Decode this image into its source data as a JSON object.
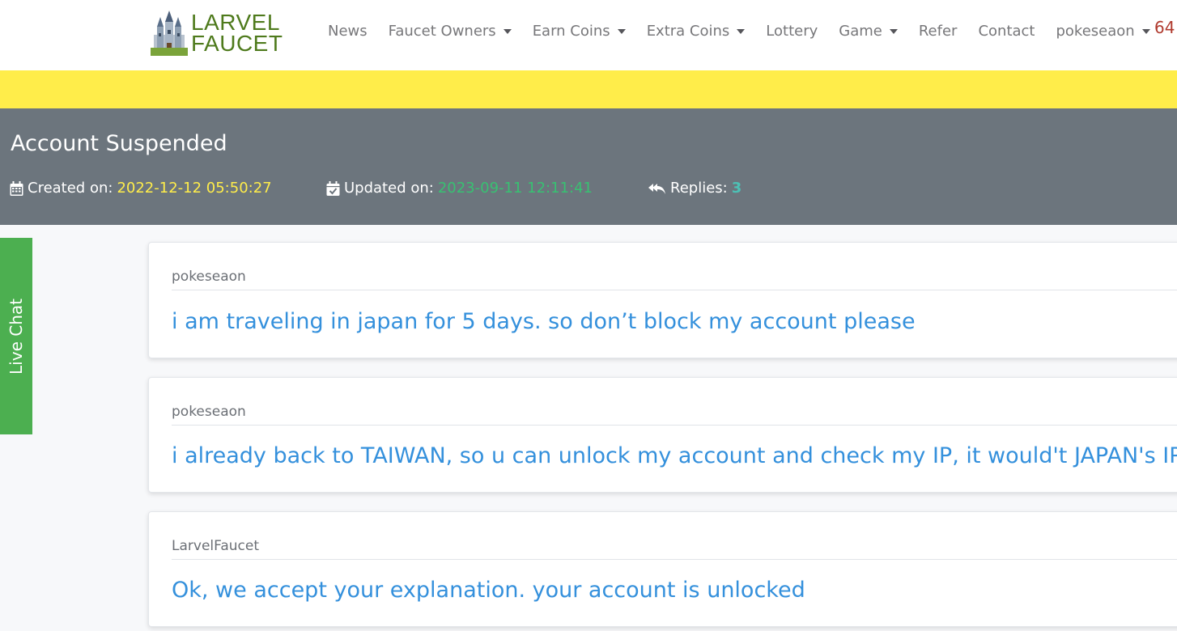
{
  "brand": {
    "line1": "LARVEL",
    "line2": "FAUCET"
  },
  "nav": {
    "items": [
      {
        "label": "News",
        "dropdown": false
      },
      {
        "label": "Faucet Owners",
        "dropdown": true
      },
      {
        "label": "Earn Coins",
        "dropdown": true
      },
      {
        "label": "Extra Coins",
        "dropdown": true
      },
      {
        "label": "Lottery",
        "dropdown": false
      },
      {
        "label": "Game",
        "dropdown": true
      },
      {
        "label": "Refer",
        "dropdown": false
      },
      {
        "label": "Contact",
        "dropdown": false
      },
      {
        "label": "pokeseaon",
        "dropdown": true
      }
    ],
    "balance": "64"
  },
  "ticket": {
    "title": "Account Suspended",
    "created_label": "Created on:",
    "created_value": "2022-12-12 05:50:27",
    "updated_label": "Updated on:",
    "updated_value": "2023-09-11 12:11:41",
    "replies_label": "Replies:",
    "replies_value": "3"
  },
  "live_chat": {
    "label": "Live Chat"
  },
  "replies": [
    {
      "author": "pokeseaon",
      "message": "i am traveling in japan for 5 days. so don’t block my account please"
    },
    {
      "author": "pokeseaon",
      "message": "i already back to TAIWAN, so u can unlock my account and check my IP, it would't JAPAN's IP"
    },
    {
      "author": "LarvelFaucet",
      "message": "Ok, we accept your explanation. your account is unlocked"
    }
  ],
  "colors": {
    "yellow_band": "#ffed4a",
    "header_bg": "#6c757d",
    "created_value": "#ffed4a",
    "updated_value": "#38c172",
    "replies_value": "#4dc0b5",
    "live_chat_bg": "#4caf50",
    "message_text": "#3490dc",
    "brand_green": "#4e7a1c",
    "balance": "#b03a2e"
  },
  "icons": {
    "created": "calendar-icon",
    "updated": "calendar-check-icon",
    "replies": "reply-all-icon"
  }
}
